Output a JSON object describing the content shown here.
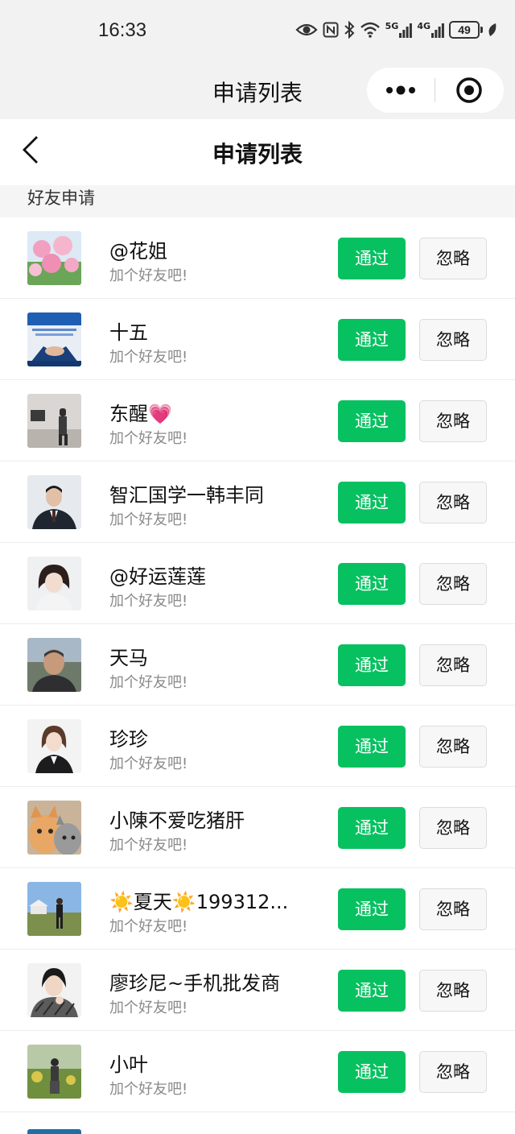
{
  "status": {
    "time": "16:33",
    "signal1": "5G",
    "signal2": "4G",
    "battery": "49"
  },
  "mp": {
    "title": "申请列表",
    "more_icon": "more-dots-icon",
    "close_icon": "target-close-icon"
  },
  "header": {
    "title": "申请列表",
    "back_icon": "chevron-left-icon"
  },
  "section": {
    "label": "好友申请"
  },
  "buttons": {
    "accept": "通过",
    "ignore": "忽略"
  },
  "requests": [
    {
      "name": "@花姐",
      "message": "加个好友吧!",
      "avatar": "pink-roses"
    },
    {
      "name": "十五",
      "message": "加个好友吧!",
      "avatar": "blue-handshake"
    },
    {
      "name": "东醒💗",
      "message": "加个好友吧!",
      "avatar": "room-figure"
    },
    {
      "name": "智汇国学一韩丰同",
      "message": "加个好友吧!",
      "avatar": "man-in-suit"
    },
    {
      "name": "@好运莲莲",
      "message": "加个好友吧!",
      "avatar": "woman-portrait"
    },
    {
      "name": "天马",
      "message": "加个好友吧!",
      "avatar": "man-outdoor"
    },
    {
      "name": "珍珍",
      "message": "加个好友吧!",
      "avatar": "woman-suit"
    },
    {
      "name": "小陳不爱吃猪肝",
      "message": "加个好友吧!",
      "avatar": "cats"
    },
    {
      "name": "☀️夏天☀️199312...",
      "message": "加个好友吧!",
      "avatar": "person-field"
    },
    {
      "name": "廖珍尼~手机批发商",
      "message": "加个好友吧!",
      "avatar": "woman-plaid"
    },
    {
      "name": "小叶",
      "message": "加个好友吧!",
      "avatar": "person-greenery"
    }
  ]
}
